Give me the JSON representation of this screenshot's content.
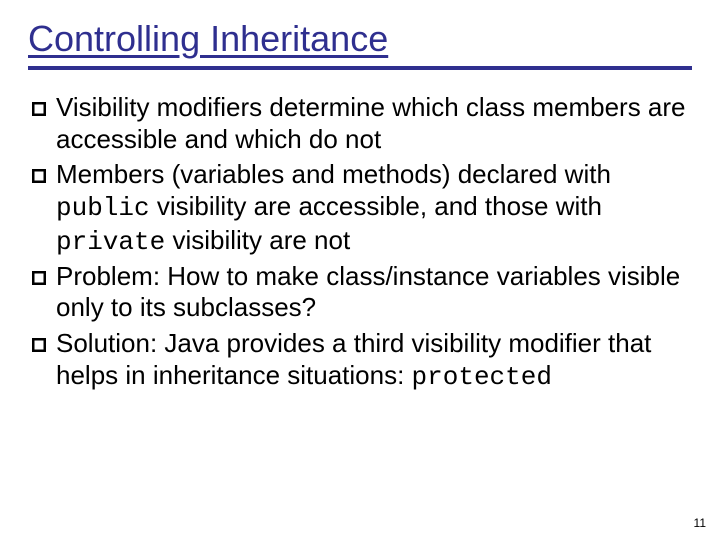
{
  "title": "Controlling Inheritance",
  "bullets": [
    {
      "pre": "Visibility modifiers determine which class members are accessible and which do not",
      "code1": "",
      "mid": "",
      "code2": "",
      "post": ""
    },
    {
      "pre": "Members (variables and methods) declared with ",
      "code1": "public",
      "mid": " visibility are accessible, and those with ",
      "code2": "private",
      "post": " visibility are not"
    },
    {
      "pre": "Problem: How to make class/instance variables visible only to its subclasses?",
      "code1": "",
      "mid": "",
      "code2": "",
      "post": ""
    },
    {
      "pre": "Solution: Java provides a third visibility modifier that helps in inheritance situations: ",
      "code1": "protected",
      "mid": "",
      "code2": "",
      "post": ""
    }
  ],
  "pageNumber": "11"
}
